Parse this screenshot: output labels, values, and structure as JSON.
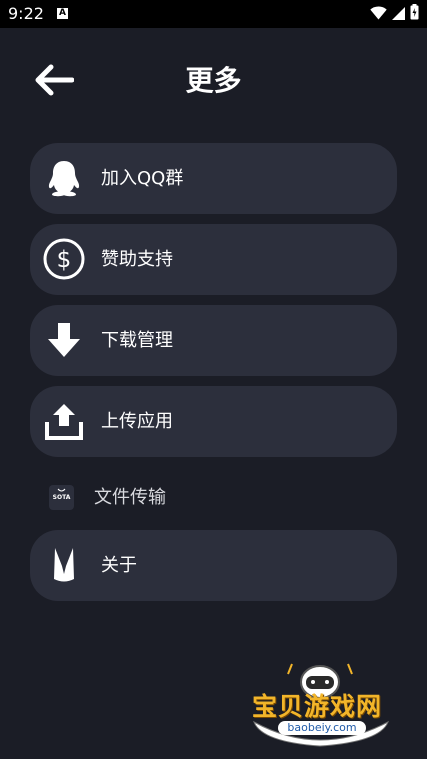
{
  "status_bar": {
    "time": "9:22",
    "notification_icon": "A"
  },
  "header": {
    "back_icon": "arrow-left-icon",
    "title": "更多"
  },
  "menu": {
    "items": [
      {
        "label": "加入QQ群",
        "icon": "qq-penguin-icon"
      },
      {
        "label": "赞助支持",
        "icon": "dollar-circle-icon"
      },
      {
        "label": "下载管理",
        "icon": "download-arrow-icon"
      },
      {
        "label": "上传应用",
        "icon": "upload-icon"
      }
    ],
    "file_transfer": {
      "label": "文件传输",
      "icon": "sota-icon",
      "icon_text": "SOTA"
    },
    "about": {
      "label": "关于",
      "icon": "app-logo-icon"
    }
  },
  "watermark": {
    "text": "宝贝游戏网",
    "url": "baobeiy.com"
  },
  "colors": {
    "background": "#1b1d26",
    "card": "#2c2f3c",
    "status_bar": "#000000",
    "watermark": "#f2b52a"
  }
}
